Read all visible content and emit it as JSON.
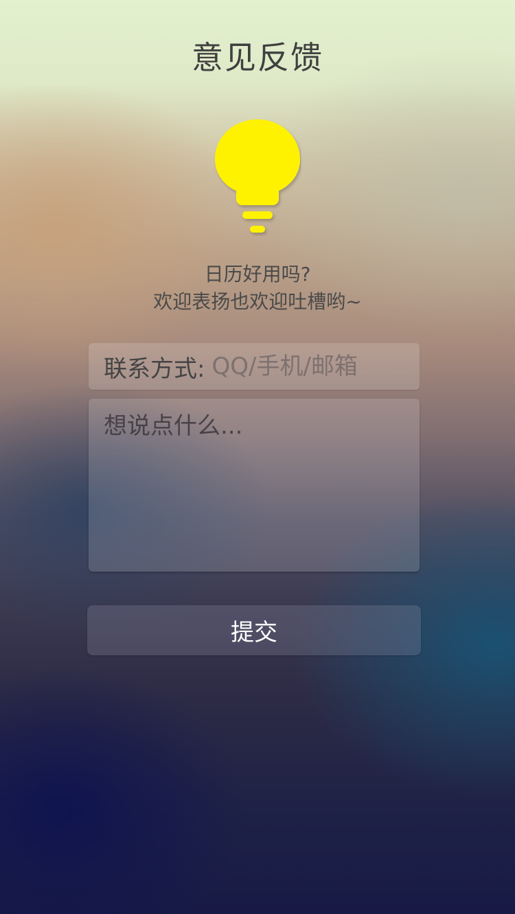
{
  "header": {
    "title": "意见反馈"
  },
  "hero": {
    "icon": "lightbulb-icon",
    "icon_color": "#fff200",
    "line1": "日历好用吗?",
    "line2": "欢迎表扬也欢迎吐槽哟~"
  },
  "form": {
    "contact_label": "联系方式:",
    "contact_placeholder": "QQ/手机/邮箱",
    "contact_value": "",
    "feedback_placeholder": "想说点什么...",
    "feedback_value": "",
    "submit_label": "提交"
  }
}
